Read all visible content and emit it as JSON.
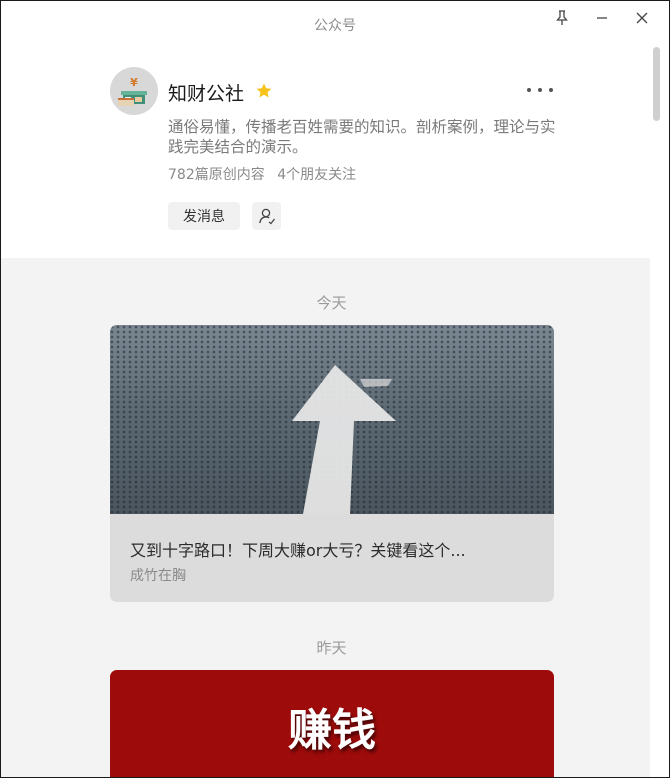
{
  "window": {
    "title": "公众号"
  },
  "account": {
    "name": "知财公社",
    "description": "通俗易懂，传播老百姓需要的知识。剖析案例，理论与实践完美结合的演示。",
    "original_count": "782篇原创内容",
    "friends_following": "4个朋友关注",
    "message_button": "发消息"
  },
  "feed": {
    "sections": [
      {
        "label": "今天",
        "article": {
          "title": "又到十字路口！下周大赚or大亏？关键看这个...",
          "author": "成竹在胸"
        }
      },
      {
        "label": "昨天",
        "article": {
          "cover_text": "赚钱"
        }
      }
    ]
  },
  "colors": {
    "star": "#f7c21a",
    "feed_background": "#f3f3f3",
    "card_background": "#dcdcdc",
    "red_cover": "#9d0b0b"
  },
  "icons": [
    "pin-icon",
    "minimize-icon",
    "close-icon",
    "star-icon",
    "more-icon",
    "follow-user-icon"
  ]
}
